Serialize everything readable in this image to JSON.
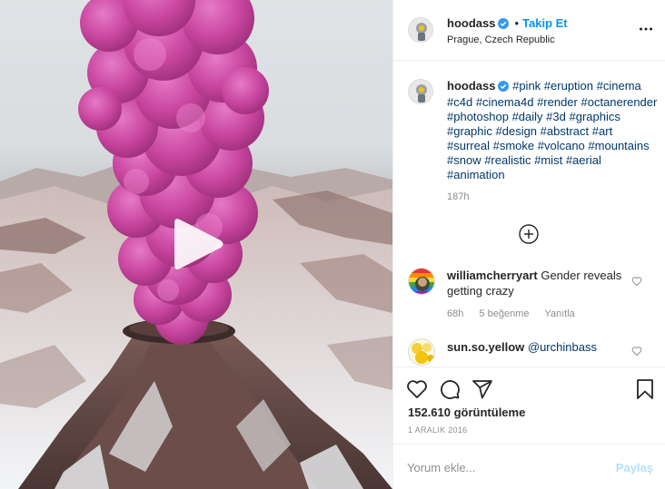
{
  "post": {
    "author": {
      "username": "hoodass",
      "verified": true,
      "follow_separator": "•",
      "follow_label": "Takip Et",
      "location": "Prague, Czech Republic"
    },
    "caption_hashtags": [
      "#pink",
      "#eruption",
      "#cinema",
      "#c4d",
      "#cinema4d",
      "#render",
      "#octanerender",
      "#photoshop",
      "#daily",
      "#3d",
      "#graphics",
      "#graphic",
      "#design",
      "#abstract",
      "#art",
      "#surreal",
      "#smoke",
      "#volcano",
      "#mountains",
      "#snow",
      "#realistic",
      "#mist",
      "#aerial",
      "#animation"
    ],
    "caption_time": "187h",
    "views": "152.610 görüntüleme",
    "date": "1 ARALIK 2016"
  },
  "comments": [
    {
      "username": "williamcherryart",
      "text": "Gender reveals getting crazy",
      "time": "68h",
      "likes": "5 beğenme",
      "reply_label": "Yanıtla"
    },
    {
      "username": "sun.so.yellow",
      "mention": "@urchinbass"
    }
  ],
  "composer": {
    "placeholder": "Yorum ekle...",
    "share_label": "Paylaş"
  },
  "icons": {
    "verified": "verified-badge-icon",
    "more": "more-options-icon",
    "play": "play-icon",
    "load_more": "plus-circle-icon",
    "like": "heart-icon",
    "comment": "comment-bubble-icon",
    "share": "paper-plane-icon",
    "save": "bookmark-icon"
  },
  "colors": {
    "accent": "#0095f6",
    "hashtag": "#00376b",
    "muted": "#8e8e8e",
    "smoke": "#c8459e"
  }
}
